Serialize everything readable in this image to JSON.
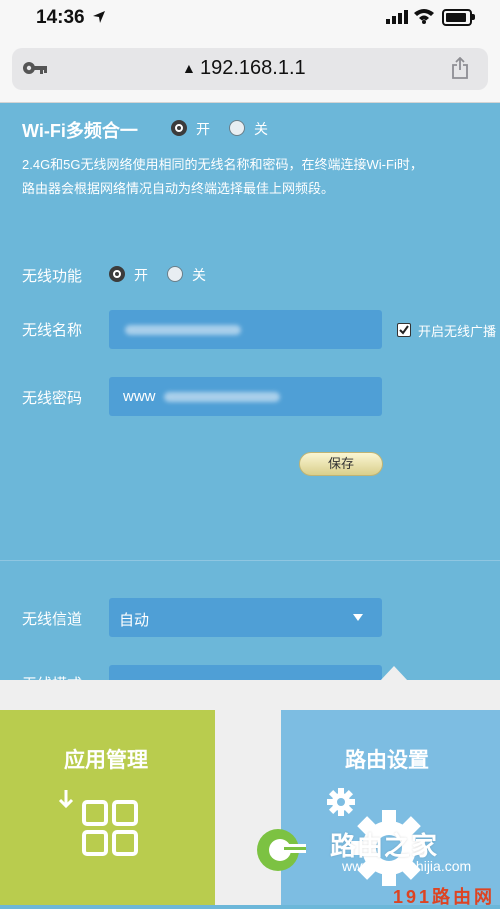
{
  "status_bar": {
    "time": "14:36"
  },
  "browser": {
    "url": "192.168.1.1"
  },
  "wifi_merge": {
    "title": "Wi-Fi多频合一",
    "option_on": "开",
    "option_off": "关",
    "selected": "开",
    "description_line1": "2.4G和5G无线网络使用相同的无线名称和密码，在终端连接Wi-Fi时，",
    "description_line2": "路由器会根据网络情况自动为终端选择最佳上网频段。"
  },
  "wireless": {
    "function_label": "无线功能",
    "function_on": "开",
    "function_off": "关",
    "function_selected": "开",
    "name_label": "无线名称",
    "name_value": "",
    "broadcast_label": "开启无线广播",
    "broadcast_checked": true,
    "password_label": "无线密码",
    "password_value_prefix": "www",
    "save_button": "保存"
  },
  "advanced": {
    "channel_label": "无线信道",
    "channel_value": "自动",
    "mode_label": "无线模式"
  },
  "bottom_tiles": {
    "app_manage": "应用管理",
    "router_settings": "路由设置"
  },
  "watermark": {
    "brand": "路由之家",
    "url": "www.luyouzhijia.com",
    "bottom": "191路由网"
  },
  "colors": {
    "panel_bg": "#6cb7d9",
    "field_bg": "#4f9fd6",
    "app_tile": "#b9cc4e",
    "router_tile": "#7dbde2"
  }
}
